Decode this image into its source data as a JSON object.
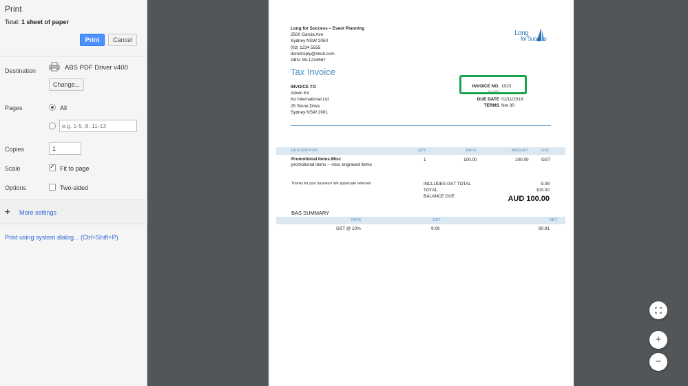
{
  "sidebar": {
    "title": "Print",
    "total_prefix": "Total: ",
    "total_value": "1 sheet of paper",
    "print_label": "Print",
    "cancel_label": "Cancel",
    "destination": {
      "label": "Destination",
      "printer_name": "ABS PDF Driver v400",
      "change_label": "Change..."
    },
    "pages": {
      "label": "Pages",
      "all_label": "All",
      "range_placeholder": "e.g. 1-5, 8, 11-13"
    },
    "copies": {
      "label": "Copies",
      "value": "1"
    },
    "scale": {
      "label": "Scale",
      "fit_label": "Fit to page"
    },
    "options": {
      "label": "Options",
      "two_sided_label": "Two-sided"
    },
    "more_settings_label": "More settings",
    "system_dialog_label": "Print using system dialog... (Ctrl+Shift+P)"
  },
  "invoice": {
    "business": {
      "name": "Long for Success – Event Planning",
      "address1": "2500 Garcia Ave",
      "address2": "Sydney NSW  2050",
      "phone": "(02) 1234 5555",
      "email": "donotreply@intuit.com",
      "abn": "ABN: 99-1234567"
    },
    "logo_line1": "Long",
    "logo_line2": "for Success",
    "title": "Tax Invoice",
    "invoice_to": {
      "label": "INVOICE TO",
      "name": "Adwin Ko",
      "company": "Ko International Ltd",
      "street": "25 Stone Drive",
      "city": "Sydney NSW  2001"
    },
    "meta": {
      "invoice_no_label": "INVOICE NO.",
      "invoice_no": "1023",
      "date_label": "DATE",
      "due_date_label": "DUE DATE",
      "due_date": "01/11/2019",
      "terms_label": "TERMS",
      "terms": "Net 30"
    },
    "columns": {
      "description": "DESCRIPTION",
      "qty": "QTY",
      "rate": "RATE",
      "amount": "AMOUNT",
      "gst": "GST"
    },
    "line_item": {
      "name": "Promotional Items:Misc",
      "description": "promotional items -- misc engraved items",
      "qty": "1",
      "rate": "100.00",
      "amount": "100.00",
      "gst": "GST"
    },
    "thank_you": "Thanks for your business!  We appreciate referrals!",
    "totals": {
      "gst_total_label": "INCLUDES GST TOTAL",
      "gst_total": "9.09",
      "total_label": "TOTAL",
      "total": "100.00",
      "balance_due_label": "BALANCE DUE",
      "balance_due": "AUD 100.00"
    },
    "bas": {
      "title": "BAS SUMMARY",
      "col_rate": "RATE",
      "col_gst": "GST",
      "col_net": "NET",
      "row_rate": "GST @ 10%",
      "row_gst": "9.09",
      "row_net": "90.91"
    }
  },
  "zoom": {
    "fit_icon": "fit-to-page-icon",
    "zoom_in_icon": "zoom-in-icon",
    "zoom_out_icon": "zoom-out-icon"
  },
  "colors": {
    "print_button": "#4d90fe",
    "link": "#3367d6",
    "highlight_box": "#1aa34a",
    "invoice_accent": "#4a8fc2"
  }
}
